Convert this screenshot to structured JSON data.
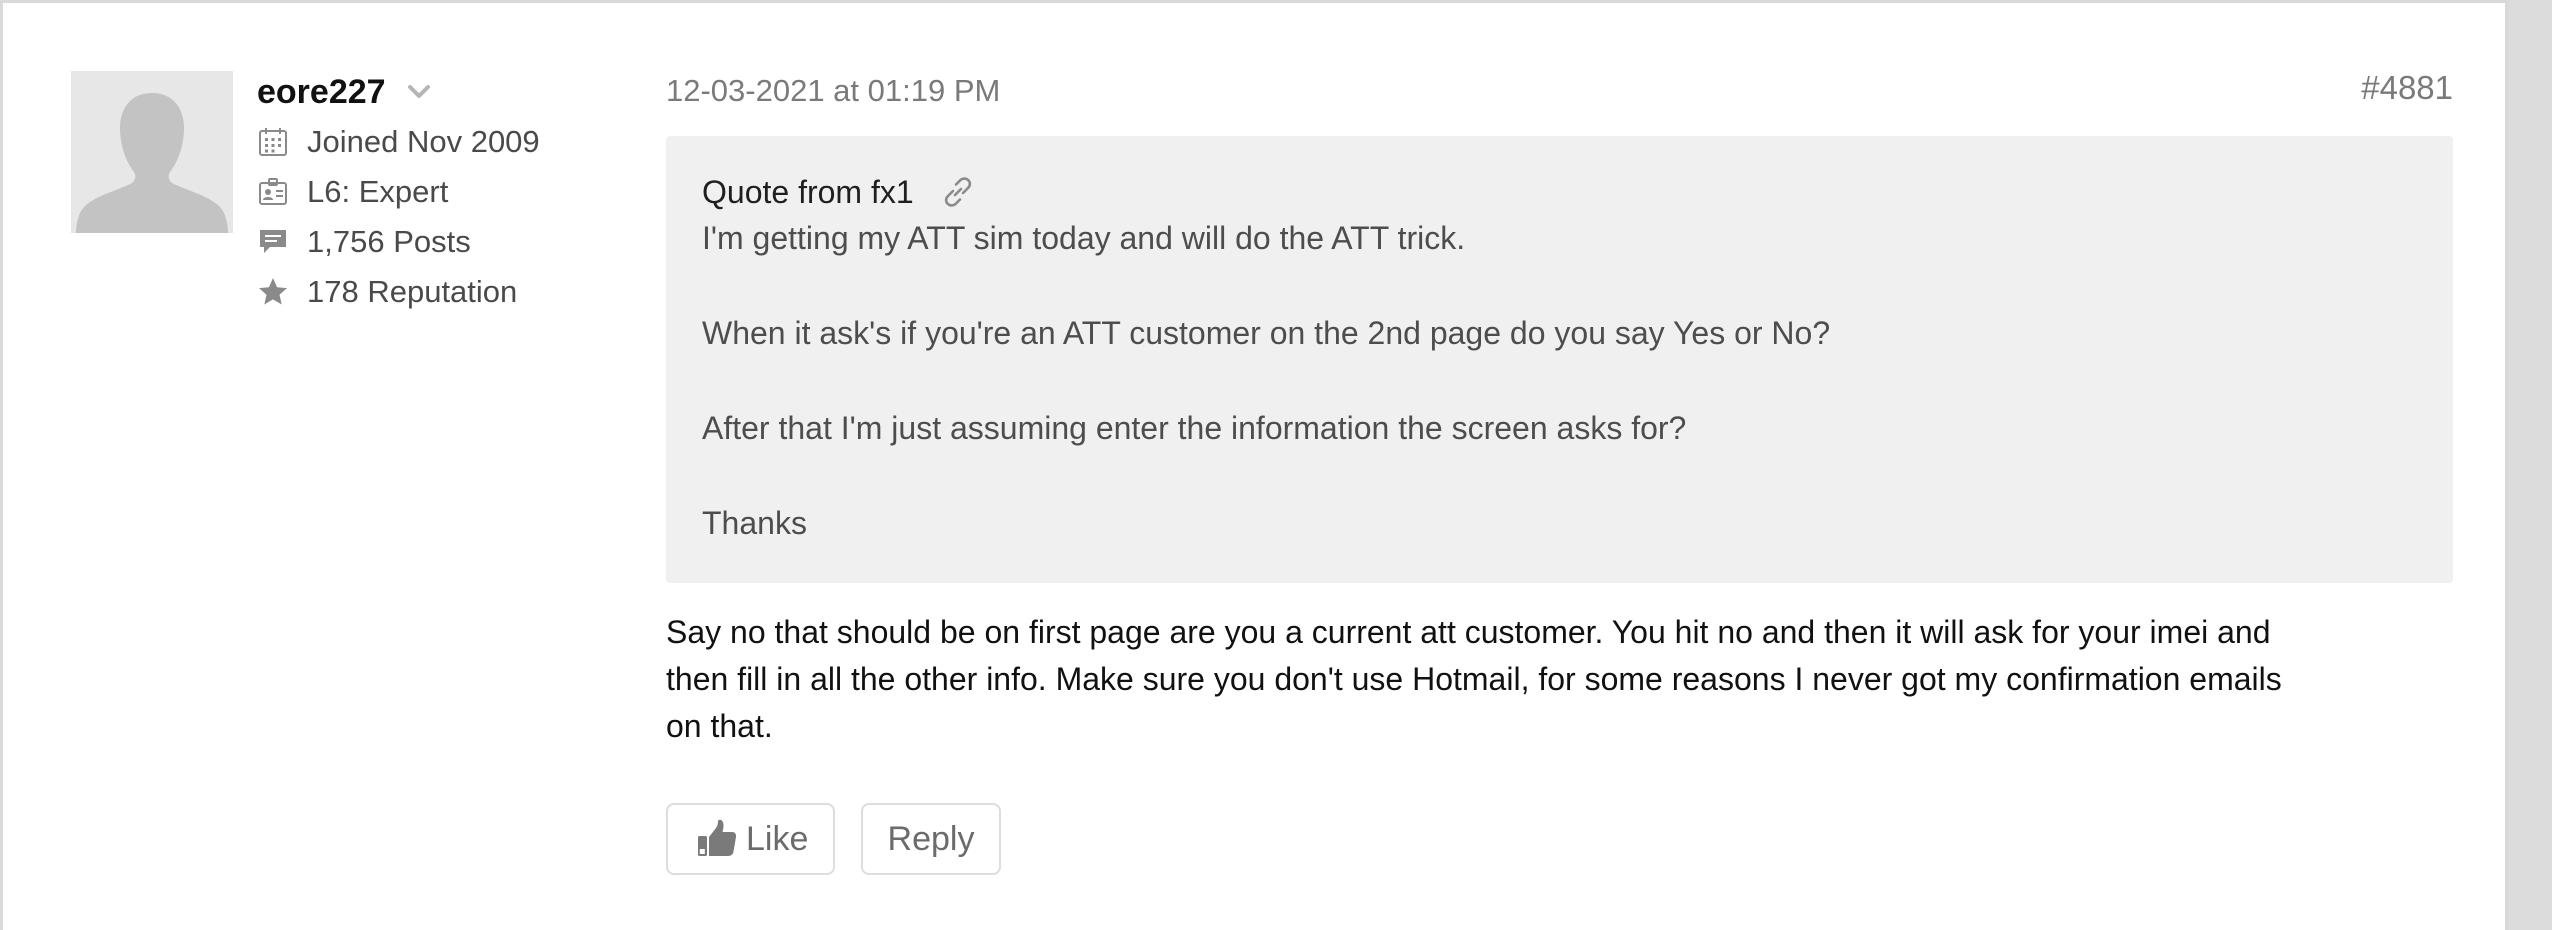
{
  "author": {
    "avatar_icon": "default-user-avatar-icon",
    "username": "eore227",
    "menu_icon": "chevron-down-icon",
    "stats": [
      {
        "icon": "calendar-icon",
        "text": "Joined Nov 2009"
      },
      {
        "icon": "id-badge-icon",
        "text": "L6: Expert"
      },
      {
        "icon": "speech-bubble-icon",
        "text": "1,756 Posts"
      },
      {
        "icon": "star-icon",
        "text": "178 Reputation"
      }
    ]
  },
  "post": {
    "date": "12-03-2021 at 01:19 PM",
    "number": "#4881",
    "quote": {
      "header": "Quote from fx1",
      "link_icon": "link-icon",
      "lines": [
        "I'm getting my ATT sim today and will do the ATT trick.",
        "When it ask's if you're an ATT customer on the 2nd page do you say Yes or No?",
        "After that I'm just assuming enter the information the screen asks for?",
        "Thanks"
      ]
    },
    "body_lines": [
      "Say no that should be on first page are you a current att customer. You hit no and then it will ask for your imei and",
      "then fill in all the other info. Make sure you don't use Hotmail, for some reasons I never got my confirmation emails",
      "on that."
    ]
  },
  "actions": {
    "like_label": "Like",
    "like_icon": "thumbs-up-icon",
    "reply_label": "Reply"
  },
  "colors": {
    "quote_background": "#f0f0f0",
    "muted_text": "#7a7a7a",
    "border": "#dddddd",
    "icon_gray": "#8a8a8a"
  }
}
